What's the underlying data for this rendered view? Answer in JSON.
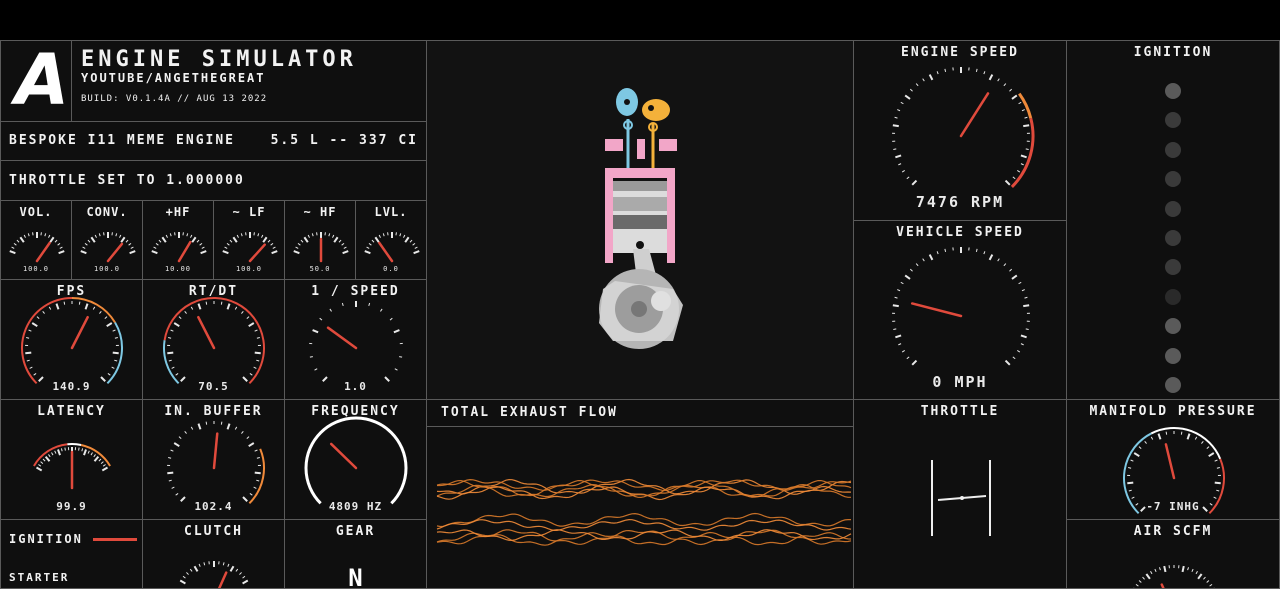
{
  "header": {
    "logo_letter": "A",
    "title": "ENGINE SIMULATOR",
    "channel": "YOUTUBE/ANGETHEGREAT",
    "build": "BUILD: V0.1.4A // AUG 13 2022"
  },
  "engine": {
    "name": "BESPOKE I11 MEME ENGINE",
    "displacement": "5.5 L -- 337 CI",
    "throttle_status": "THROTTLE SET TO 1.000000"
  },
  "audio_gauges": [
    {
      "label": "VOL.",
      "value": "100.0"
    },
    {
      "label": "CONV.",
      "value": "100.0"
    },
    {
      "label": "+HF",
      "value": "10.00"
    },
    {
      "label": "~ LF",
      "value": "100.0"
    },
    {
      "label": "~ HF",
      "value": "50.0"
    },
    {
      "label": "LVL.",
      "value": "0.0"
    }
  ],
  "perf": {
    "fps": {
      "label": "FPS",
      "value": "140.9"
    },
    "rtdt": {
      "label": "RT/DT",
      "value": "70.5"
    },
    "speed": {
      "label": "1 / SPEED",
      "value": "1.0"
    },
    "latency": {
      "label": "LATENCY",
      "value": "99.9"
    },
    "in_buffer": {
      "label": "IN. BUFFER",
      "value": "102.4"
    },
    "frequency": {
      "label": "FREQUENCY",
      "value": "4809 HZ"
    }
  },
  "engine_speed": {
    "label": "ENGINE SPEED",
    "value": "7476 RPM"
  },
  "vehicle_speed": {
    "label": "VEHICLE SPEED",
    "value": "0 MPH"
  },
  "ignition_panel": {
    "label": "IGNITION"
  },
  "exhaust": {
    "label": "TOTAL EXHAUST FLOW"
  },
  "throttle_panel": {
    "label": "THROTTLE"
  },
  "manifold": {
    "label": "MANIFOLD PRESSURE",
    "value": "-7 INHG"
  },
  "air": {
    "label": "AIR SCFM"
  },
  "controls": {
    "ignition": "IGNITION",
    "starter": "STARTER",
    "clutch": "CLUTCH",
    "gear": "GEAR",
    "gear_value": "N"
  },
  "colors": {
    "background": "#0f0f0f",
    "border": "#5a5a5a",
    "needle": "#e04a3c",
    "accent_orange": "#f08a3a",
    "accent_blue": "#7ec8e3",
    "piston_pink": "#f2a6c8",
    "exhaust_orange": "#f28c38"
  }
}
